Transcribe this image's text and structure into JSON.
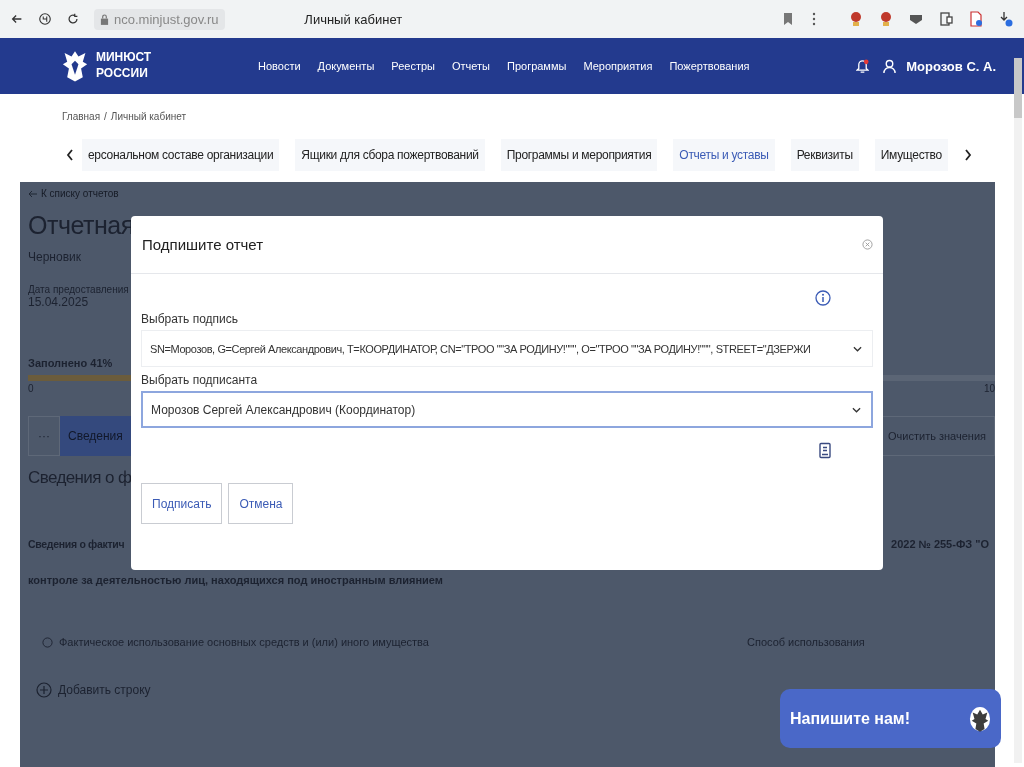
{
  "browser": {
    "url": "nco.minjust.gov.ru",
    "title": "Личный кабинет"
  },
  "header": {
    "logo_lines": [
      "МИНЮСТ",
      "РОССИИ"
    ],
    "nav": [
      "Новости",
      "Документы",
      "Реестры",
      "Отчеты",
      "Программы",
      "Мероприятия",
      "Пожертвования"
    ],
    "notification": true,
    "user": "Морозов С. А."
  },
  "breadcrumb": {
    "items": [
      "Главная",
      "Личный кабинет"
    ],
    "separator": "/"
  },
  "section_tabs": [
    {
      "label": "ерсональном составе организации",
      "selected": false
    },
    {
      "label": "Ящики для сбора пожертвований",
      "selected": false
    },
    {
      "label": "Программы и мероприятия",
      "selected": false
    },
    {
      "label": "Отчеты и уставы",
      "selected": true
    },
    {
      "label": "Реквизиты",
      "selected": false
    },
    {
      "label": "Имущество",
      "selected": false
    }
  ],
  "background": {
    "back_link": "К списку отчетов",
    "title": "Отчетная",
    "status": "Черновик",
    "date_label": "Дата предоставления",
    "date": "15.04.2025",
    "progress": {
      "label": "Заполнено 41%",
      "level": 0.41,
      "min": "0",
      "max": "10"
    },
    "tab_more": "···",
    "tab_current": "Сведения",
    "clear": "Очистить значения",
    "heading": "Сведения о ф",
    "para_start": "Сведения о фактич",
    "para_end": "2022 № 255-ФЗ \"О",
    "para_line2": "контроле за деятельностью лиц, находящихся под иностранным влиянием",
    "columns": [
      "Фактическое использование основных средств и (или) иного имущества",
      "Способ использования"
    ],
    "add_row": "Добавить строку"
  },
  "dialog": {
    "title": "Подпишите отчет",
    "fields": [
      {
        "label": "Выбрать подпись",
        "value": "SN=Морозов, G=Сергей Александрович, T=КООРДИНАТОР, CN=\"ТРОО \"\"ЗА РОДИНУ!\"\"\", O=\"ТРОО \"\"ЗА РОДИНУ!\"\"\", STREET=\"ДЗЕРЖИ",
        "focused": false
      },
      {
        "label": "Выбрать подписанта",
        "value": "Морозов Сергей Александрович (Координатор)",
        "focused": true
      }
    ],
    "buttons": [
      "Подписать",
      "Отмена"
    ]
  },
  "chat": {
    "label": "Напишите нам!"
  }
}
